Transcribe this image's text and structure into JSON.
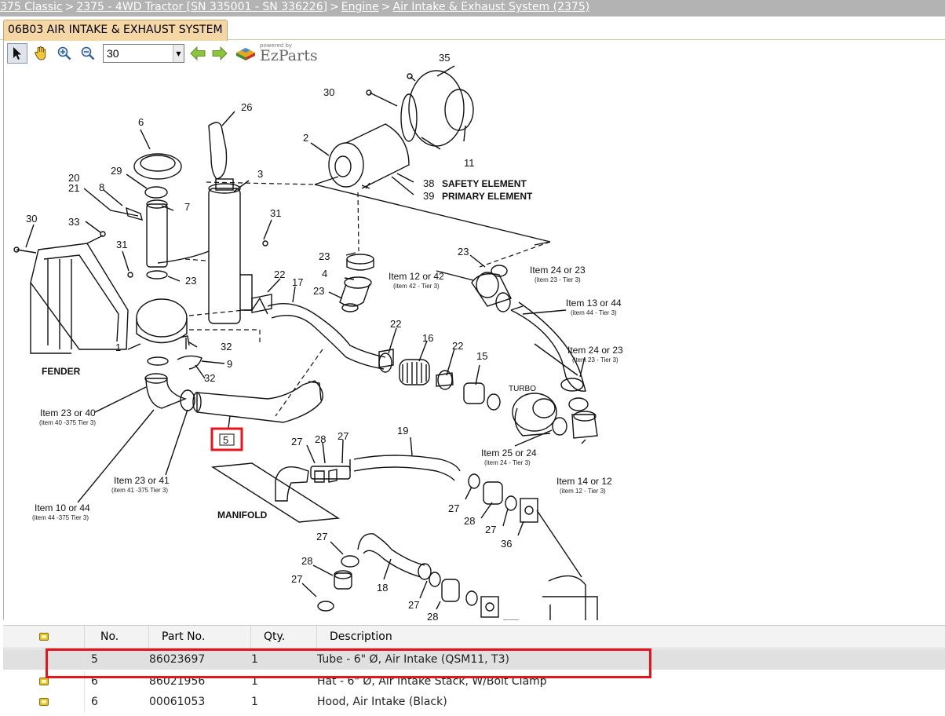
{
  "breadcrumb": {
    "items": [
      "375 Classic",
      "2375 - 4WD Tractor [SN 335001 - SN 336226]",
      "Engine",
      "Air Intake & Exhaust System (2375)"
    ],
    "separator": ">"
  },
  "tab": {
    "label": "06B03 AIR INTAKE & EXHAUST SYSTEM"
  },
  "toolbar": {
    "tools": [
      "pointer-icon",
      "pan-hand-icon",
      "zoom-in-icon",
      "zoom-out-icon"
    ],
    "zoom_value": "30",
    "nav": [
      "previous-arrow-icon",
      "next-arrow-icon"
    ],
    "brand_powered": "powered by",
    "brand_name": "EzParts"
  },
  "diagram": {
    "callouts": {
      "n35": "35",
      "n30a": "30",
      "n2": "2",
      "n11": "11",
      "n38": "38",
      "n39": "39",
      "n6": "6",
      "n26": "26",
      "n3": "3",
      "n29": "29",
      "n20": "20",
      "n21": "21",
      "n8": "8",
      "n7": "7",
      "n30b": "30",
      "n33": "33",
      "n31a": "31",
      "n31b": "31",
      "n23a": "23",
      "n23b": "23",
      "n23c": "23",
      "n23d": "23",
      "n4": "4",
      "n22a": "22",
      "n17": "17",
      "n1": "1",
      "n32a": "32",
      "n9": "9",
      "n32b": "32",
      "n22b": "22",
      "n16": "16",
      "n22c": "22",
      "n15": "15",
      "n5": "5",
      "n19": "19",
      "n27a": "27",
      "n28a": "28",
      "n27b": "27",
      "n27c": "27",
      "n28b": "28",
      "n27d": "27",
      "n36": "36",
      "n27e": "27",
      "n28c": "28",
      "n27f": "27",
      "n18": "18",
      "n27g": "27",
      "n28d": "28"
    },
    "labels": {
      "safety": "SAFETY ELEMENT",
      "primary": "PRIMARY ELEMENT",
      "fender": "FENDER",
      "manifold": "MANIFOLD",
      "turbo": "TURBO",
      "item12or42": "Item 12 or 42",
      "item12or42_sub": "(item 42 - Tier 3)",
      "item24or23a": "Item 24 or 23",
      "item24or23a_sub": "(item 23 - Tier 3)",
      "item13or44": "Item 13 or 44",
      "item13or44_sub": "(item 44 - Tier 3)",
      "item24or23b": "Item 24 or 23",
      "item24or23b_sub": "(item 23 - Tier 3)",
      "item23or40": "Item 23 or 40",
      "item23or40_sub": "(item 40 -375 Tier 3)",
      "item23or41": "Item 23 or 41",
      "item23or41_sub": "(item 41 -375 Tier 3)",
      "item10or44": "Item 10 or 44",
      "item10or44_sub": "(item 44 -375  Tier 3)",
      "item25or24": "Item 25 or 24",
      "item25or24_sub": "(item 24 - Tier 3)",
      "item14or12": "Item 14 or 12",
      "item14or12_sub": "(item 12 - Tier 3)"
    }
  },
  "table": {
    "headers": {
      "no": "No.",
      "part": "Part No.",
      "qty": "Qty.",
      "desc": "Description"
    },
    "rows": [
      {
        "no": "5",
        "part": "86023697",
        "qty": "1",
        "desc": "Tube - 6\" Ø, Air Intake (QSM11, T3)",
        "selected": true
      },
      {
        "no": "6",
        "part": "86021956",
        "qty": "1",
        "desc": "Hat - 6\" Ø, Air Intake Stack, W/Bolt Clamp",
        "selected": false
      },
      {
        "no": "6",
        "part": "00061053",
        "qty": "1",
        "desc": "Hood, Air Intake (Black)",
        "selected": false
      }
    ]
  },
  "colors": {
    "highlight": "#e8141b",
    "tab_bg": "#f5d7a6",
    "breadcrumb_bg": "#b3b3b3"
  }
}
